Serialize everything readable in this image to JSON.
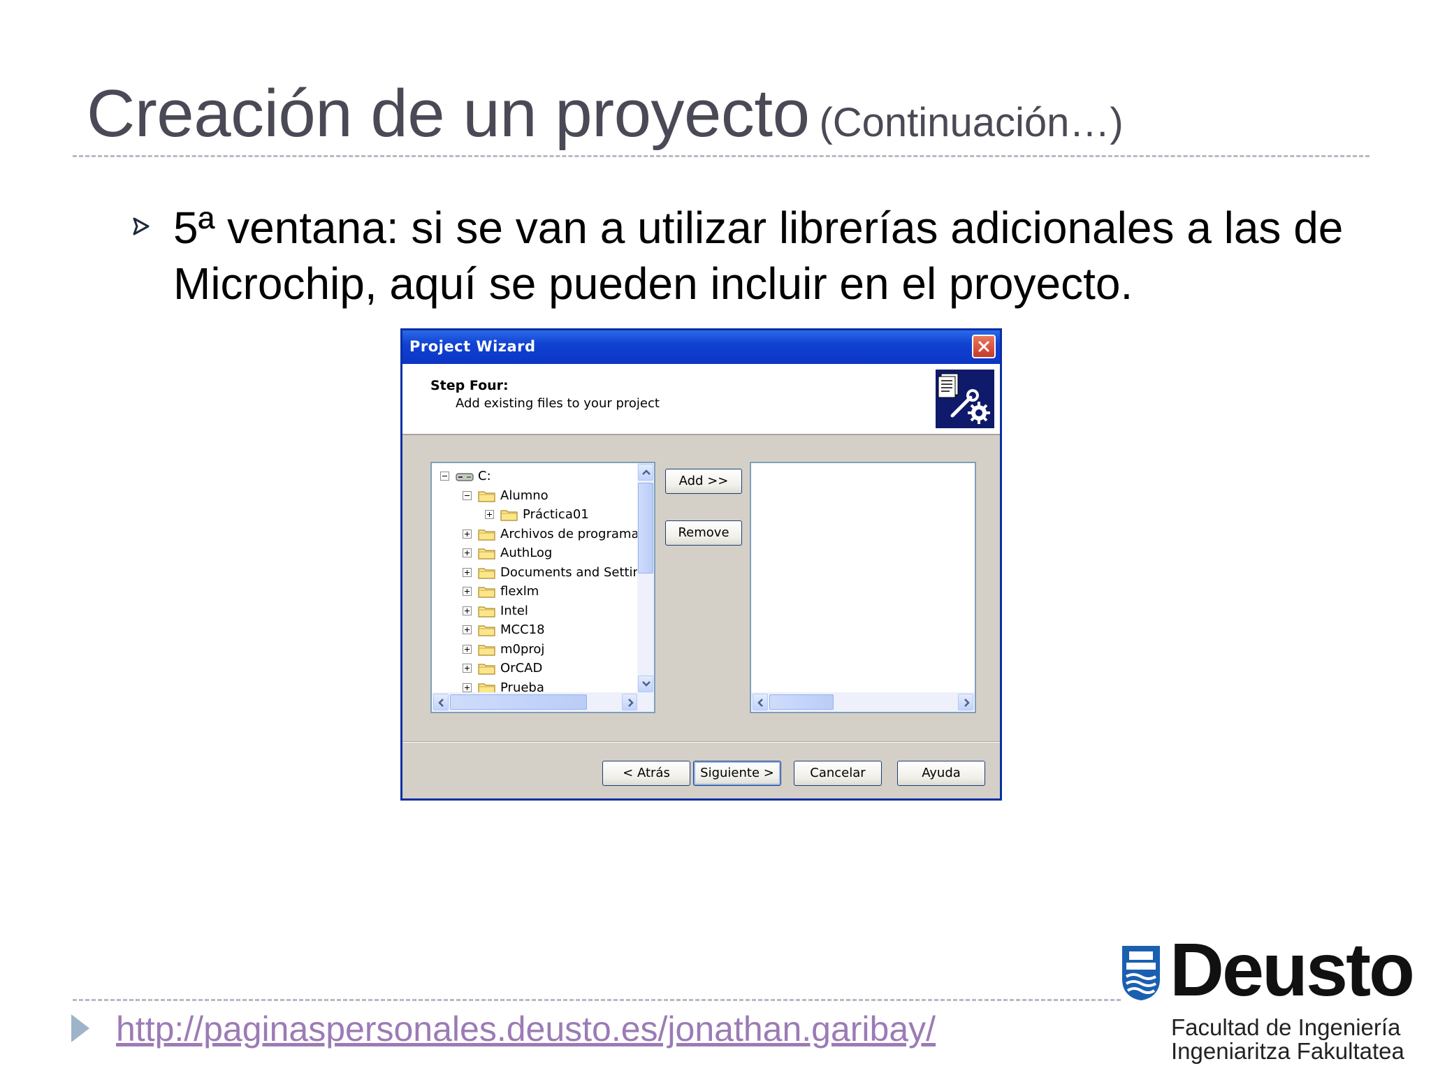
{
  "slide": {
    "title": "Creación de un proyecto",
    "title_sub": "(Continuación…)",
    "bullet": "5ª ventana: si se van a utilizar librerías adicionales a las de Microchip, aquí se pueden incluir en el proyecto.",
    "footer_link": "http://paginaspersonales.deusto.es/jonathan.garibay/"
  },
  "logo": {
    "word": "Deusto",
    "line1": "Facultad de Ingeniería",
    "line2": "Ingeniaritza Fakultatea"
  },
  "window": {
    "title": "Project Wizard",
    "step_title": "Step Four:",
    "step_desc": "Add existing files to your project",
    "icon": "wizard-tools-icon"
  },
  "tree": {
    "items": [
      {
        "label": "C:",
        "level": 0,
        "state": "minus",
        "icon": "drive-icon"
      },
      {
        "label": "Alumno",
        "level": 1,
        "state": "minus",
        "icon": "folder-icon"
      },
      {
        "label": "Práctica01",
        "level": 2,
        "state": "plus",
        "icon": "folder-icon"
      },
      {
        "label": "Archivos de programa",
        "level": 1,
        "state": "plus",
        "icon": "folder-icon"
      },
      {
        "label": "AuthLog",
        "level": 1,
        "state": "plus",
        "icon": "folder-icon"
      },
      {
        "label": "Documents and Settin",
        "level": 1,
        "state": "plus",
        "icon": "folder-icon"
      },
      {
        "label": "flexlm",
        "level": 1,
        "state": "plus",
        "icon": "folder-icon"
      },
      {
        "label": "Intel",
        "level": 1,
        "state": "plus",
        "icon": "folder-icon"
      },
      {
        "label": "MCC18",
        "level": 1,
        "state": "plus",
        "icon": "folder-icon"
      },
      {
        "label": "m0proj",
        "level": 1,
        "state": "plus",
        "icon": "folder-icon"
      },
      {
        "label": "OrCAD",
        "level": 1,
        "state": "plus",
        "icon": "folder-icon"
      },
      {
        "label": "Prueba",
        "level": 1,
        "state": "plus",
        "icon": "folder-icon"
      }
    ]
  },
  "buttons": {
    "add": "Add >>",
    "remove": "Remove",
    "back": "< Atrás",
    "next": "Siguiente >",
    "cancel": "Cancelar",
    "help": "Ayuda"
  },
  "colors": {
    "titlebar": "#0b36c4",
    "link": "#9b7bb5",
    "bullet_marker": "#1f2a3a",
    "logo_blue": "#1b5fb0"
  }
}
